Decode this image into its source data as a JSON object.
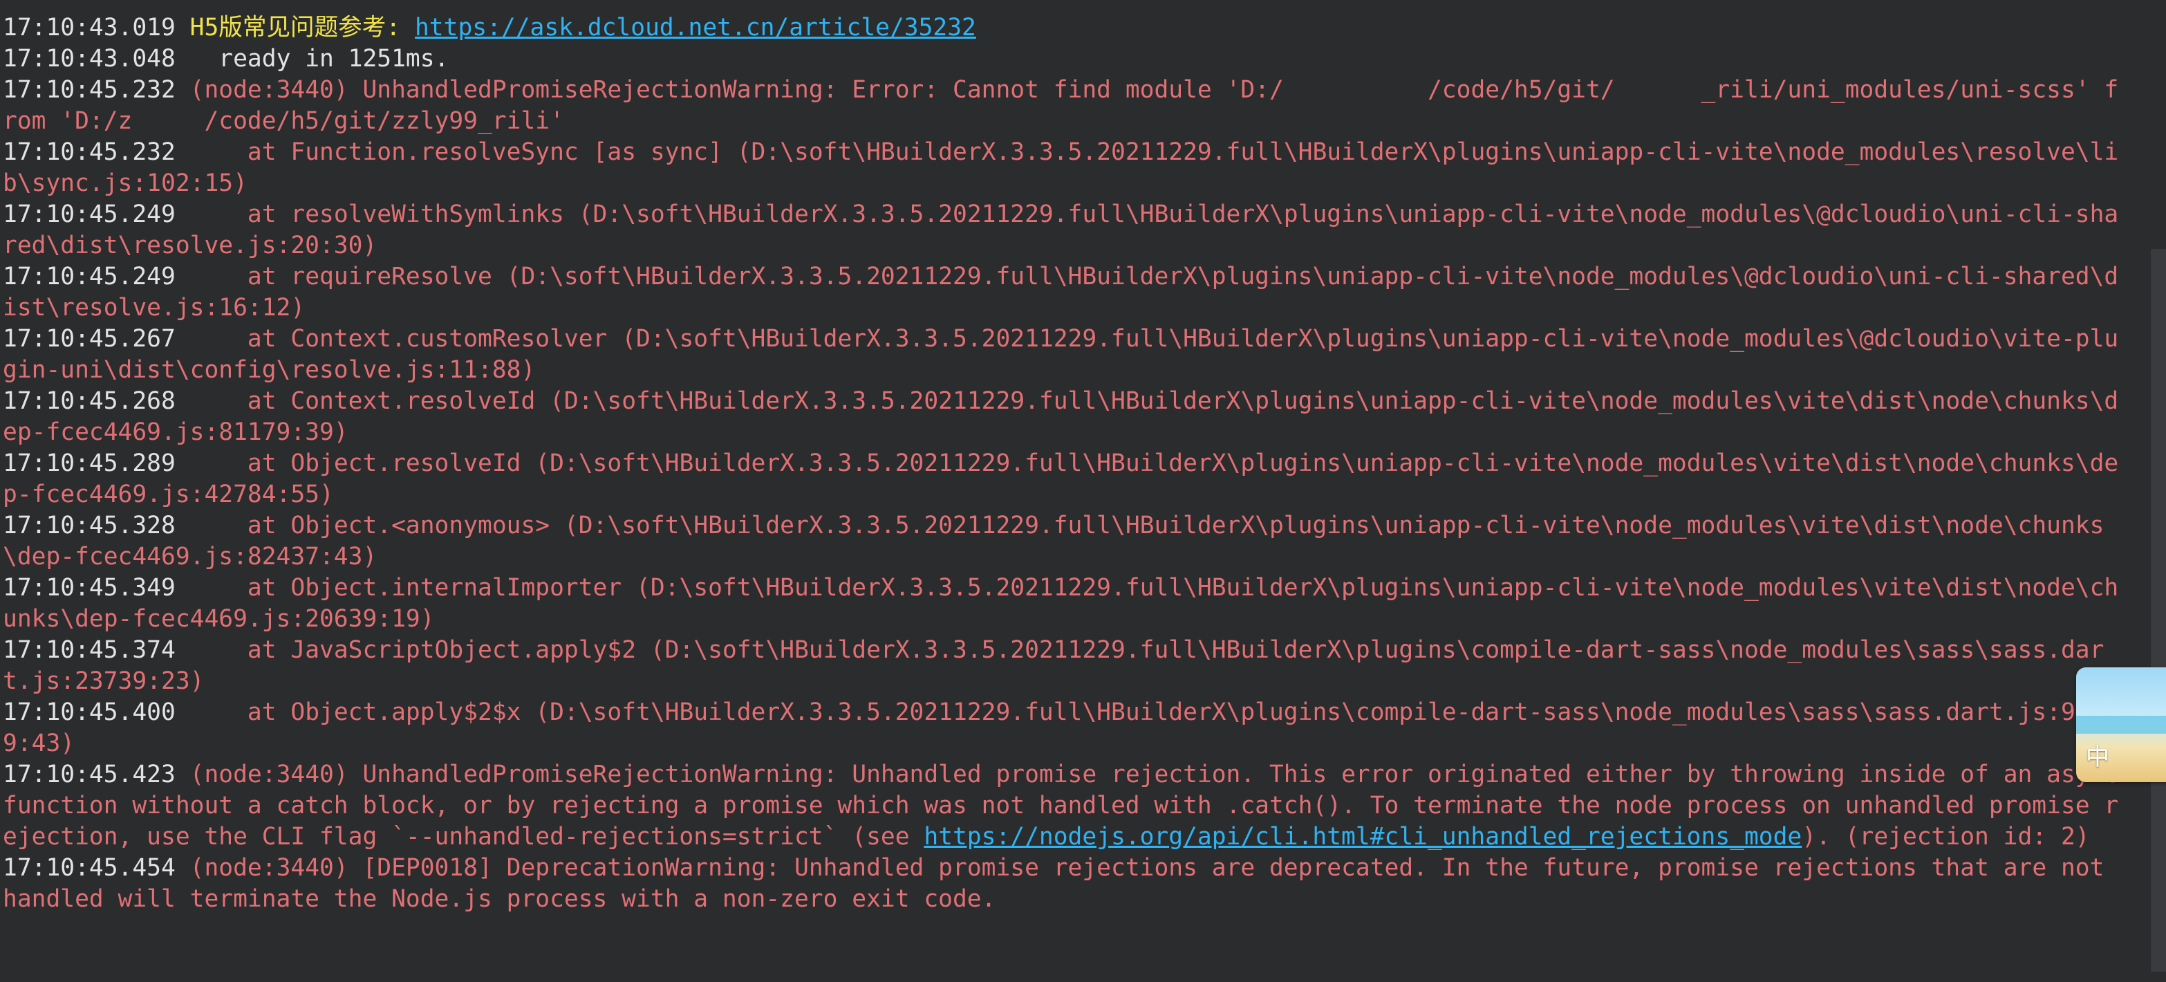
{
  "console": {
    "lines": [
      {
        "ts": "17:10:43.019",
        "type": "info",
        "text": "H5版常见问题参考: ",
        "link": "https://ask.dcloud.net.cn/article/35232"
      },
      {
        "ts": "17:10:43.048",
        "type": "plain",
        "text": "  ready in 1251ms."
      },
      {
        "ts": "17:10:45.232",
        "type": "error",
        "text": "(node:3440) UnhandledPromiseRejectionWarning: Error: Cannot find module 'D:/          /code/h5/git/      _rili/uni_modules/uni-scss' from 'D:/z     /code/h5/git/zzly99_rili'"
      },
      {
        "ts": "17:10:45.232",
        "type": "error",
        "text": "    at Function.resolveSync [as sync] (D:\\soft\\HBuilderX.3.3.5.20211229.full\\HBuilderX\\plugins\\uniapp-cli-vite\\node_modules\\resolve\\lib\\sync.js:102:15)"
      },
      {
        "ts": "17:10:45.249",
        "type": "error",
        "text": "    at resolveWithSymlinks (D:\\soft\\HBuilderX.3.3.5.20211229.full\\HBuilderX\\plugins\\uniapp-cli-vite\\node_modules\\@dcloudio\\uni-cli-shared\\dist\\resolve.js:20:30)"
      },
      {
        "ts": "17:10:45.249",
        "type": "error",
        "text": "    at requireResolve (D:\\soft\\HBuilderX.3.3.5.20211229.full\\HBuilderX\\plugins\\uniapp-cli-vite\\node_modules\\@dcloudio\\uni-cli-shared\\dist\\resolve.js:16:12)"
      },
      {
        "ts": "17:10:45.267",
        "type": "error",
        "text": "    at Context.customResolver (D:\\soft\\HBuilderX.3.3.5.20211229.full\\HBuilderX\\plugins\\uniapp-cli-vite\\node_modules\\@dcloudio\\vite-plugin-uni\\dist\\config\\resolve.js:11:88)"
      },
      {
        "ts": "17:10:45.268",
        "type": "error",
        "text": "    at Context.resolveId (D:\\soft\\HBuilderX.3.3.5.20211229.full\\HBuilderX\\plugins\\uniapp-cli-vite\\node_modules\\vite\\dist\\node\\chunks\\dep-fcec4469.js:81179:39)"
      },
      {
        "ts": "17:10:45.289",
        "type": "error",
        "text": "    at Object.resolveId (D:\\soft\\HBuilderX.3.3.5.20211229.full\\HBuilderX\\plugins\\uniapp-cli-vite\\node_modules\\vite\\dist\\node\\chunks\\dep-fcec4469.js:42784:55)"
      },
      {
        "ts": "17:10:45.328",
        "type": "error",
        "text": "    at Object.<anonymous> (D:\\soft\\HBuilderX.3.3.5.20211229.full\\HBuilderX\\plugins\\uniapp-cli-vite\\node_modules\\vite\\dist\\node\\chunks\\dep-fcec4469.js:82437:43)"
      },
      {
        "ts": "17:10:45.349",
        "type": "error",
        "text": "    at Object.internalImporter (D:\\soft\\HBuilderX.3.3.5.20211229.full\\HBuilderX\\plugins\\uniapp-cli-vite\\node_modules\\vite\\dist\\node\\chunks\\dep-fcec4469.js:20639:19)"
      },
      {
        "ts": "17:10:45.374",
        "type": "error",
        "text": "    at JavaScriptObject.apply$2 (D:\\soft\\HBuilderX.3.3.5.20211229.full\\HBuilderX\\plugins\\compile-dart-sass\\node_modules\\sass\\sass.dart.js:23739:23)"
      },
      {
        "ts": "17:10:45.400",
        "type": "error",
        "text": "    at Object.apply$2$x (D:\\soft\\HBuilderX.3.3.5.20211229.full\\HBuilderX\\plugins\\compile-dart-sass\\node_modules\\sass\\sass.dart.js:9149:43)"
      },
      {
        "ts": "17:10:45.423",
        "type": "error",
        "text": "(node:3440) UnhandledPromiseRejectionWarning: Unhandled promise rejection. This error originated either by throwing inside of an async function without a catch block, or by rejecting a promise which was not handled with .catch(). To terminate the node process on unhandled promise rejection, use the CLI flag `--unhandled-rejections=strict` (see ",
        "link": "https://nodejs.org/api/cli.html#cli_unhandled_rejections_mode",
        "after": "). (rejection id: 2)"
      },
      {
        "ts": "17:10:45.454",
        "type": "error",
        "text": "(node:3440) [DEP0018] DeprecationWarning: Unhandled promise rejections are deprecated. In the future, promise rejections that are not handled will terminate the Node.js process with a non-zero exit code."
      }
    ]
  },
  "ime_badge": {
    "label": "中"
  },
  "colors": {
    "background": "#2b2c2e",
    "timestamp": "#e3e3e3",
    "info": "#f2e34a",
    "error": "#e07074",
    "link": "#2fb3f2"
  }
}
